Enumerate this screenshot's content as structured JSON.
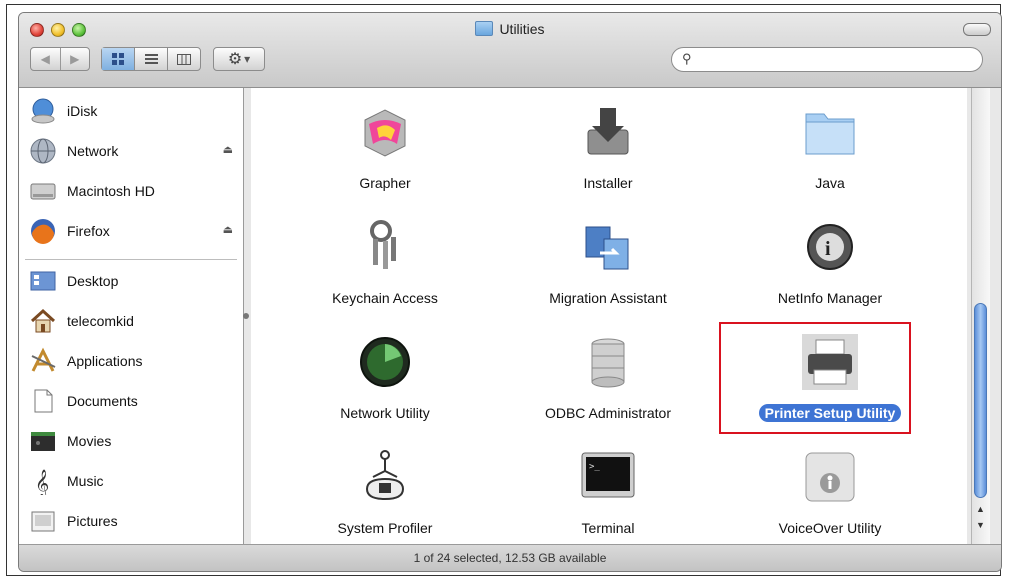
{
  "window": {
    "title": "Utilities"
  },
  "toolbar": {
    "back_glyph": "◀",
    "forward_glyph": "▶",
    "view_icons": [
      "icon-view-icon",
      "list-view-icon",
      "column-view-icon"
    ],
    "action_label": "▾"
  },
  "search": {
    "glyph": "⚲",
    "placeholder": ""
  },
  "sidebar": {
    "devices": [
      {
        "label": "iDisk",
        "icon": "idisk-icon"
      },
      {
        "label": "Network",
        "icon": "network-icon",
        "eject": "⏏"
      },
      {
        "label": "Macintosh HD",
        "icon": "hard-drive-icon"
      },
      {
        "label": "Firefox",
        "icon": "firefox-icon",
        "eject": "⏏"
      }
    ],
    "places": [
      {
        "label": "Desktop",
        "icon": "desktop-icon"
      },
      {
        "label": "telecomkid",
        "icon": "home-icon"
      },
      {
        "label": "Applications",
        "icon": "applications-icon"
      },
      {
        "label": "Documents",
        "icon": "documents-icon"
      },
      {
        "label": "Movies",
        "icon": "movies-icon"
      },
      {
        "label": "Music",
        "icon": "music-icon"
      },
      {
        "label": "Pictures",
        "icon": "pictures-icon"
      }
    ]
  },
  "items": [
    {
      "label": "Grapher",
      "icon": "grapher-icon"
    },
    {
      "label": "Installer",
      "icon": "installer-icon"
    },
    {
      "label": "Java",
      "icon": "java-folder-icon"
    },
    {
      "label": "Keychain Access",
      "icon": "keychain-icon"
    },
    {
      "label": "Migration Assistant",
      "icon": "migration-assistant-icon"
    },
    {
      "label": "NetInfo Manager",
      "icon": "netinfo-icon"
    },
    {
      "label": "Network Utility",
      "icon": "network-utility-icon"
    },
    {
      "label": "ODBC Administrator",
      "icon": "odbc-icon"
    },
    {
      "label": "Printer Setup Utility",
      "icon": "printer-icon",
      "selected": true
    },
    {
      "label": "System Profiler",
      "icon": "system-profiler-icon"
    },
    {
      "label": "Terminal",
      "icon": "terminal-icon"
    },
    {
      "label": "VoiceOver Utility",
      "icon": "voiceover-icon"
    }
  ],
  "scrollbar": {
    "up": "▲",
    "down": "▼"
  },
  "status": {
    "text": "1 of 24 selected, 12.53 GB available"
  },
  "colors": {
    "selection": "#3e74d4",
    "highlight_box": "#d9121f",
    "scroll_thumb": "#5c8fd9"
  }
}
